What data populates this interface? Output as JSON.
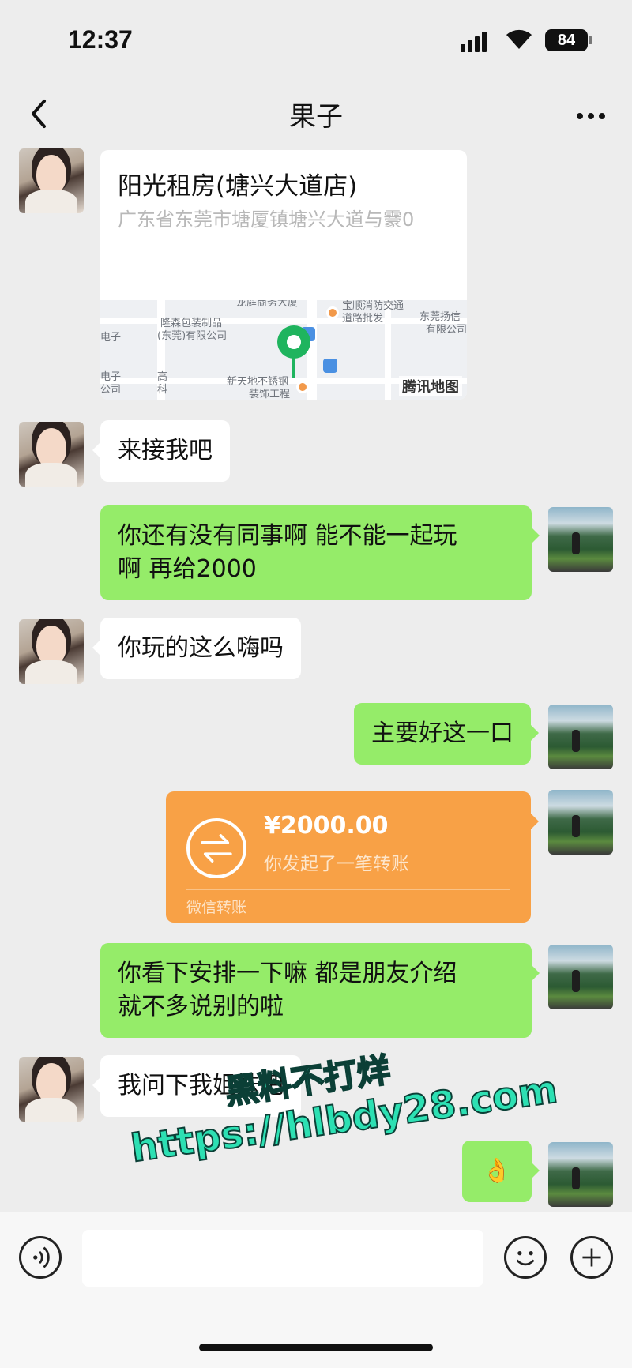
{
  "status_bar": {
    "time": "12:37",
    "battery": "84"
  },
  "nav": {
    "title": "果子"
  },
  "messages": [
    {
      "side": "left",
      "type": "location",
      "name": "阳光租房(塘兴大道店)",
      "address": "广东省东莞市塘厦镇塘兴大道与靀0"
    },
    {
      "side": "left",
      "type": "text",
      "text": "来接我吧"
    },
    {
      "side": "right",
      "type": "text",
      "lines": [
        "你还有没有同事啊 能不能一起玩",
        "啊 再给2000"
      ]
    },
    {
      "side": "left",
      "type": "text",
      "text": "你玩的这么嗨吗"
    },
    {
      "side": "right",
      "type": "text",
      "text": "主要好这一口"
    },
    {
      "side": "right",
      "type": "transfer",
      "amount": "¥2000.00",
      "desc": "你发起了一笔转账",
      "footer": "微信转账"
    },
    {
      "side": "right",
      "type": "text",
      "lines": [
        "你看下安排一下嘛 都是朋友介绍",
        "就不多说别的啦"
      ]
    },
    {
      "side": "left",
      "type": "text",
      "text": "我问下我姐妹吧"
    },
    {
      "side": "right",
      "type": "emoji",
      "text": "👌"
    }
  ],
  "map": {
    "labels": [
      "龙庭商务大厦",
      "宝顺消防交通",
      "道路批发",
      "东莞扬信",
      "有限公司",
      "隆森包装制品",
      "(东莞)有限公司",
      "电子",
      "电子",
      "公司",
      "高",
      "科",
      "新天地不锈钢",
      "装饰工程"
    ],
    "brand": "腾讯地图"
  },
  "watermark": {
    "line1": "黑料不打烊",
    "line2": "https://hlbdy28.com"
  },
  "input": {
    "placeholder": ""
  }
}
